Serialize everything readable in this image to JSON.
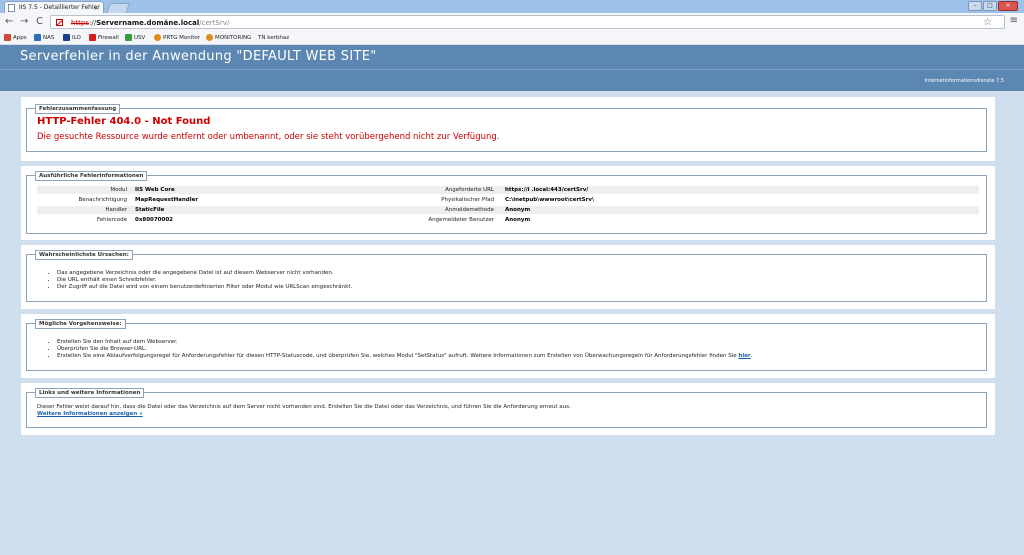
{
  "browser": {
    "tab_title": "IIS 7.5 - Detaillierter Fehler",
    "tab_close": "×",
    "url": {
      "scheme": "https",
      "separator": "://",
      "host": "Servername.domäne.local",
      "path": "/certSrv/"
    },
    "nav": {
      "back": "←",
      "forward": "→",
      "reload": "C"
    },
    "star": "☆",
    "menu": "≡",
    "window_controls": {
      "minimize": "–",
      "maximize": "□",
      "close": "×"
    },
    "bookmarks": [
      {
        "label": "Apps",
        "color": "#d04a3a"
      },
      {
        "label": "NAS",
        "color": "#2a6db8"
      },
      {
        "label": "ILO",
        "color": "#1c3f8a"
      },
      {
        "label": "Firewall",
        "color": "#d42020"
      },
      {
        "label": "USV",
        "color": "#3a9b3a"
      },
      {
        "label": "PRTG Monitor",
        "color": "#e08a18"
      },
      {
        "label": "MONITORING",
        "color": "#e08a18"
      },
      {
        "label": "TN kerbhaz",
        "color": ""
      }
    ]
  },
  "page": {
    "header_title": "Serverfehler in der Anwendung \"DEFAULT WEB SITE\"",
    "server_version": "Internetinformationsdienste 7.5",
    "summary": {
      "legend": "Fehlerzusammenfassung",
      "title": "HTTP-Fehler 404.0 - Not Found",
      "description": "Die gesuchte Ressource wurde entfernt oder umbenannt, oder sie steht vorübergehend nicht zur Verfügung."
    },
    "details": {
      "legend": "Ausführliche Fehlerinformationen",
      "left": [
        {
          "label": "Modul",
          "value": "IIS Web Core"
        },
        {
          "label": "Benachrichtigung",
          "value": "MapRequestHandler"
        },
        {
          "label": "Handler",
          "value": "StaticFile"
        },
        {
          "label": "Fehlercode",
          "value": "0x80070002"
        }
      ],
      "right": [
        {
          "label": "Angeforderte URL",
          "value": "https://i                      .local:443/certSrv/"
        },
        {
          "label": "Physikalischer Pfad",
          "value": "C:\\inetpub\\wwwroot\\certSrv\\"
        },
        {
          "label": "Anmeldemethode",
          "value": "Anonym"
        },
        {
          "label": "Angemeldeter Benutzer",
          "value": "Anonym"
        }
      ]
    },
    "causes": {
      "legend": "Wahrscheinlichste Ursachen:",
      "items": [
        "Das angegebene Verzeichnis oder die angegebene Datei ist auf diesem Webserver nicht vorhanden.",
        "Die URL enthält einen Schreibfehler.",
        "Der Zugriff auf die Datei wird von einem benutzerdefinierten Filter oder Modul wie URLScan eingeschränkt."
      ]
    },
    "actions": {
      "legend": "Mögliche Vorgehensweise:",
      "items": [
        "Erstellen Sie den Inhalt auf dem Webserver.",
        "Überprüfen Sie die Browser-URL.",
        "Erstellen Sie eine Ablaufverfolgungsregel für Anforderungsfehler für diesen HTTP-Statuscode, und überprüfen Sie, welches Modul \"SetStatus\" aufruft. Weitere Informationen zum Erstellen von Überwachungsregeln für Anforderungsfehler finden Sie "
      ],
      "link_here": "hier",
      "trailing": "."
    },
    "links": {
      "legend": "Links und weitere Informationen",
      "text": "Dieser Fehler weist darauf hin, dass die Datei oder das Verzeichnis auf dem Server nicht vorhanden sind. Erstellen Sie die Datei oder das Verzeichnis, und führen Sie die Anforderung erneut aus.",
      "more_link": "Weitere Informationen anzeigen »"
    }
  }
}
